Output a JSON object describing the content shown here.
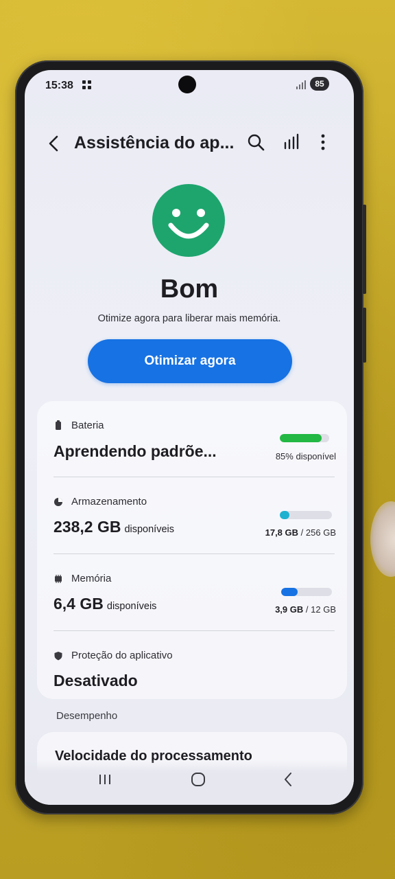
{
  "status_bar": {
    "time": "15:38",
    "battery_percent": "85"
  },
  "app_bar": {
    "title": "Assistência do ap...",
    "icons": [
      "back-icon",
      "search-icon",
      "bar-chart-icon",
      "more-options-icon"
    ]
  },
  "device_status": {
    "icon": "smiley-face-icon",
    "icon_color": "#1ea56e",
    "title": "Bom",
    "subtitle": "Otimize agora para liberar mais memória.",
    "action_label": "Otimizar agora",
    "accent_color": "#1772e3"
  },
  "sections": {
    "battery": {
      "label": "Bateria",
      "value": "Aprendendo padrõe...",
      "meta": "85% disponível",
      "level_percent": 85,
      "bar_color": "#22b843"
    },
    "storage": {
      "label": "Armazenamento",
      "value": "238,2 GB",
      "value_suffix": "disponíveis",
      "used": "17,8 GB",
      "separator": "/",
      "total": "256 GB",
      "used_fraction": 0.07,
      "bar_color": "#1fb1cf"
    },
    "memory": {
      "label": "Memória",
      "value": "6,4 GB",
      "value_suffix": "disponíveis",
      "used": "3,9 GB",
      "separator": "/",
      "total": "12 GB",
      "used_fraction": 0.33,
      "bar_color": "#1772e3"
    },
    "app_protection": {
      "label": "Proteção do aplicativo",
      "value": "Desativado"
    }
  },
  "performance": {
    "header": "Desempenho",
    "first_item": "Velocidade do processamento"
  },
  "nav_bar": {
    "icons": [
      "recent-apps-icon",
      "home-icon",
      "back-nav-icon"
    ]
  }
}
